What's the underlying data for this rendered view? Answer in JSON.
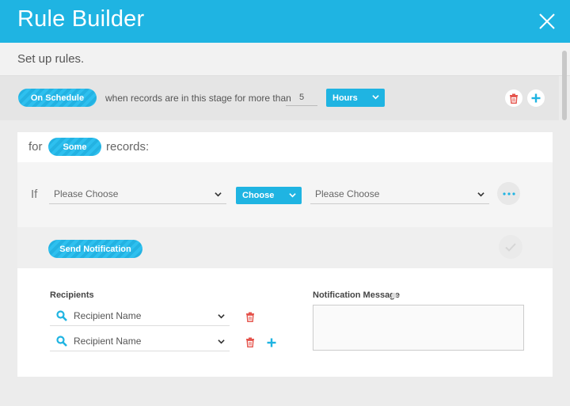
{
  "modal": {
    "title": "Rule Builder",
    "subtitle": "Set up rules."
  },
  "schedule": {
    "trigger_label": "On Schedule",
    "phrase": "when records are in this stage for more than",
    "amount": "5",
    "unit": "Hours"
  },
  "condition": {
    "for_label": "for",
    "quantifier": "Some",
    "records_label": "records:",
    "if_label": "If",
    "field_placeholder": "Please Choose",
    "operator": "Choose",
    "value_placeholder": "Please Choose"
  },
  "action": {
    "label": "Send Notification"
  },
  "notification": {
    "recipients_label": "Recipients",
    "recipients": [
      {
        "placeholder": "Recipient Name"
      },
      {
        "placeholder": "Recipient Name"
      }
    ],
    "message_label": "Notification Message"
  },
  "colors": {
    "accent": "#1fb4e2",
    "danger": "#e5534b"
  }
}
